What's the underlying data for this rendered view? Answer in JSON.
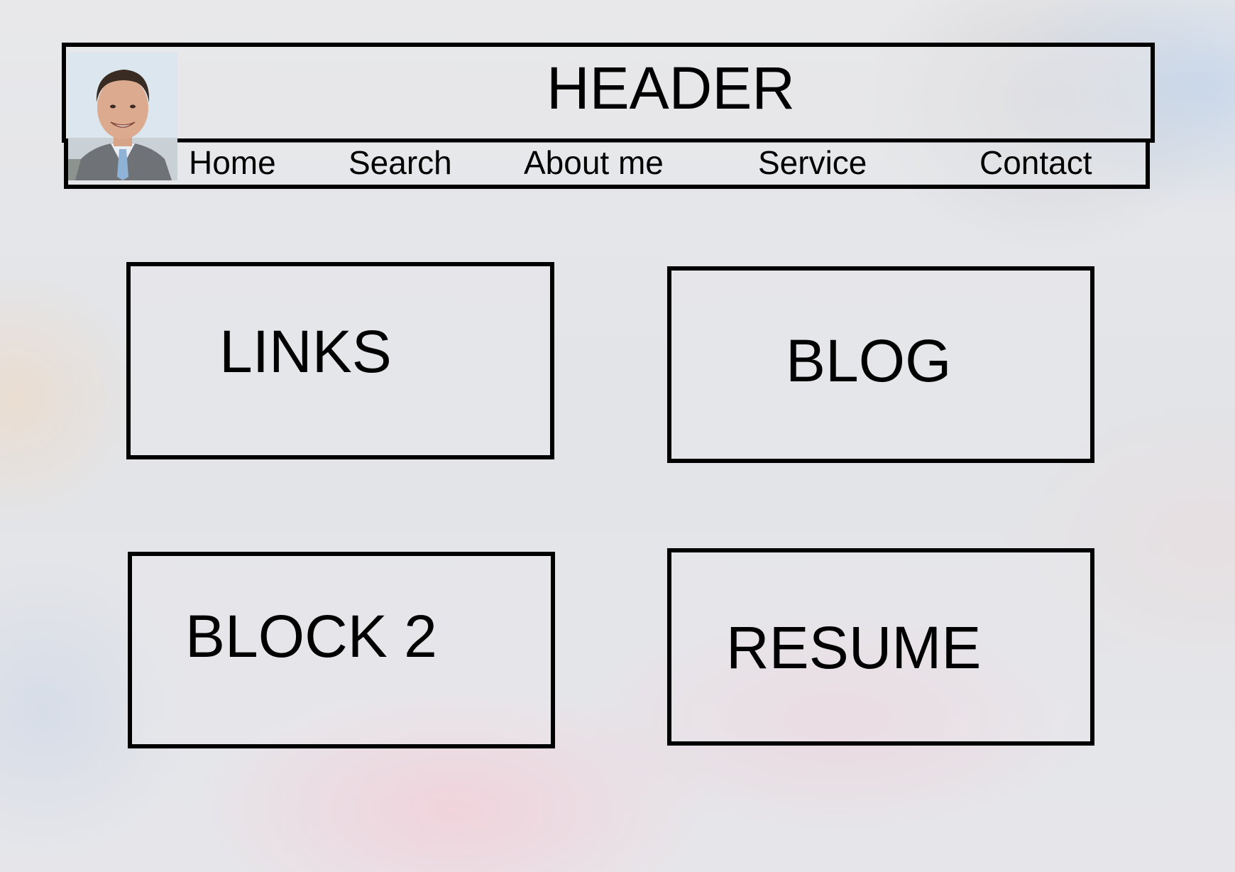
{
  "header": {
    "title": "HEADER"
  },
  "avatar": {
    "icon": "person-photo-icon"
  },
  "nav": {
    "items": [
      {
        "label": "Home"
      },
      {
        "label": "Search"
      },
      {
        "label": "About me"
      },
      {
        "label": "Service"
      },
      {
        "label": "Contact"
      }
    ]
  },
  "blocks": {
    "links": {
      "label": "LINKS"
    },
    "blog": {
      "label": "BLOG"
    },
    "block2": {
      "label": "BLOCK 2"
    },
    "resume": {
      "label": "RESUME"
    }
  }
}
